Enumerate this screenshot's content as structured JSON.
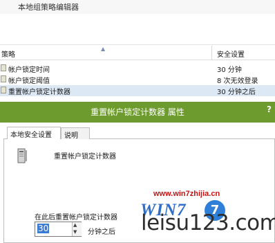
{
  "window": {
    "title": "本地组策略编辑器"
  },
  "columns": {
    "policy": "策略",
    "setting": "安全设置"
  },
  "rows": [
    {
      "name": "帐户锁定时间",
      "value": "30 分钟"
    },
    {
      "name": "帐户锁定阈值",
      "value": "8 次无效登录"
    },
    {
      "name": "重置帐户锁定计数器",
      "value": "30 分钟之后"
    }
  ],
  "dialog": {
    "title": "重置帐户锁定计数器 属性",
    "help": "?",
    "tabs": [
      "本地安全设置",
      "说明"
    ],
    "policy_name": "重置帐户锁定计数器",
    "reset_label": "在此后重置帐户锁定计数器",
    "value": "30",
    "unit": "分钟之后"
  },
  "watermark": {
    "url": "www.win7zhijia.cn",
    "logo": "WIN7",
    "badge": "7",
    "site": "leisu123.com"
  }
}
